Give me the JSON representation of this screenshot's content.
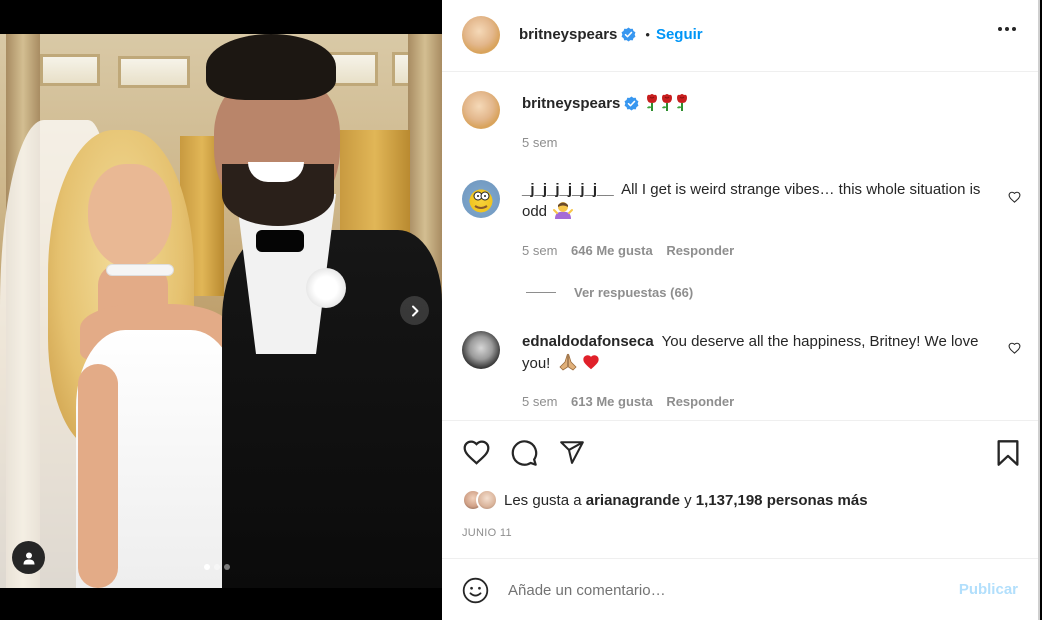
{
  "media": {
    "carousel_dots": 3,
    "active_dot": 0
  },
  "header": {
    "username": "britneyspears",
    "separator": "•",
    "follow_label": "Seguir"
  },
  "caption": {
    "username": "britneyspears",
    "time": "5 sem"
  },
  "comments": [
    {
      "username": "_j_j_j_j_j_j__",
      "text": "All I get is weird strange vibes… this whole situation is odd",
      "time": "5 sem",
      "likes": "646 Me gusta",
      "reply_label": "Responder"
    },
    {
      "username": "ednaldodafonseca",
      "text": "You deserve all the happiness, Britney! We love you!",
      "time": "5 sem",
      "likes": "613 Me gusta",
      "reply_label": "Responder"
    }
  ],
  "view_replies": "Ver respuestas (66)",
  "likes": {
    "prefix": "Les gusta a ",
    "user": "arianagrande",
    "middle": " y ",
    "count": "1,137,198 personas más"
  },
  "date": "JUNIO 11",
  "composer": {
    "placeholder": "Añade un comentario…",
    "publish_label": "Publicar"
  },
  "colors": {
    "accent": "#0095f6",
    "publish_disabled": "#b2dffc",
    "verified": "#3897f0",
    "muted": "#8e8e8e"
  }
}
